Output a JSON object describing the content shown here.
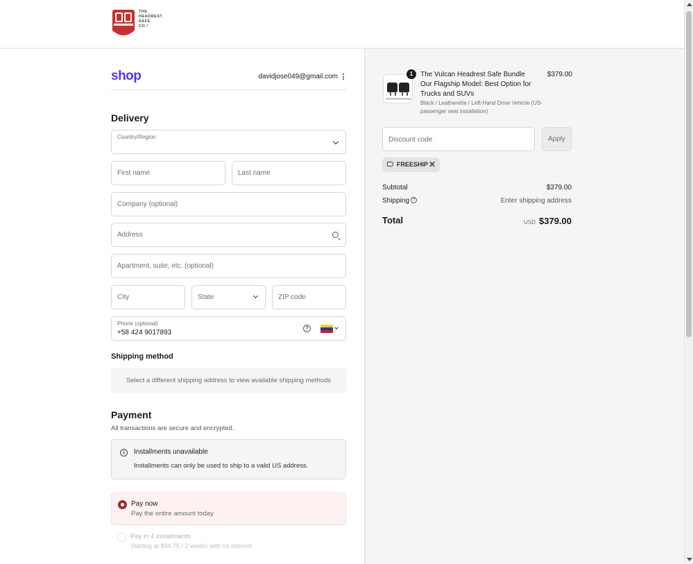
{
  "brand": {
    "logo_text_lines": [
      "THE",
      "HEADREST",
      "SAFE",
      "CO.°"
    ]
  },
  "account": {
    "shop_logo": "shop",
    "email": "davidjose049@gmail.com"
  },
  "delivery": {
    "heading": "Delivery",
    "country_label": "Country/Region",
    "first_name_placeholder": "First name",
    "last_name_placeholder": "Last name",
    "company_placeholder": "Company (optional)",
    "address_placeholder": "Address",
    "apartment_placeholder": "Apartment, suite, etc. (optional)",
    "city_placeholder": "City",
    "state_placeholder": "State",
    "zip_placeholder": "ZIP code",
    "phone_label": "Phone (optional)",
    "phone_value": "+58 424 9017893"
  },
  "shipping": {
    "heading": "Shipping method",
    "notice": "Select a different shipping address to view available shipping methods"
  },
  "payment": {
    "heading": "Payment",
    "subtitle": "All transactions are secure and encrypted.",
    "installments_title": "Installments unavailable",
    "installments_text": "Installments can only be used to ship to a valid US address.",
    "options": [
      {
        "title": "Pay now",
        "subtitle": "Pay the entire amount today",
        "selected": true
      },
      {
        "title": "Pay in 4 installments",
        "subtitle": "Starting at $94.75 / 2 weeks with no interest",
        "selected": false
      }
    ]
  },
  "order": {
    "quantity": "1",
    "product_title": "The Vulcan Headrest Safe Bundle Our Flagship Model: Best Option for Trucks and SUVs",
    "product_variant": "Black / Leatherette / Left-Hand Drive Vehicle (US-passenger seat installation)",
    "product_price": "$379.00",
    "discount_placeholder": "Discount code",
    "apply_label": "Apply",
    "discount_tag": "FREESHIP",
    "subtotal_label": "Subtotal",
    "subtotal_value": "$379.00",
    "shipping_label": "Shipping",
    "shipping_value": "Enter shipping address",
    "total_label": "Total",
    "currency": "USD",
    "total_value": "$379.00"
  },
  "colors": {
    "shop_purple": "#5a31f4",
    "brand_red": "#c9302c",
    "selected_radio": "#9b2d2d",
    "selected_bg": "#fdf1f2"
  }
}
